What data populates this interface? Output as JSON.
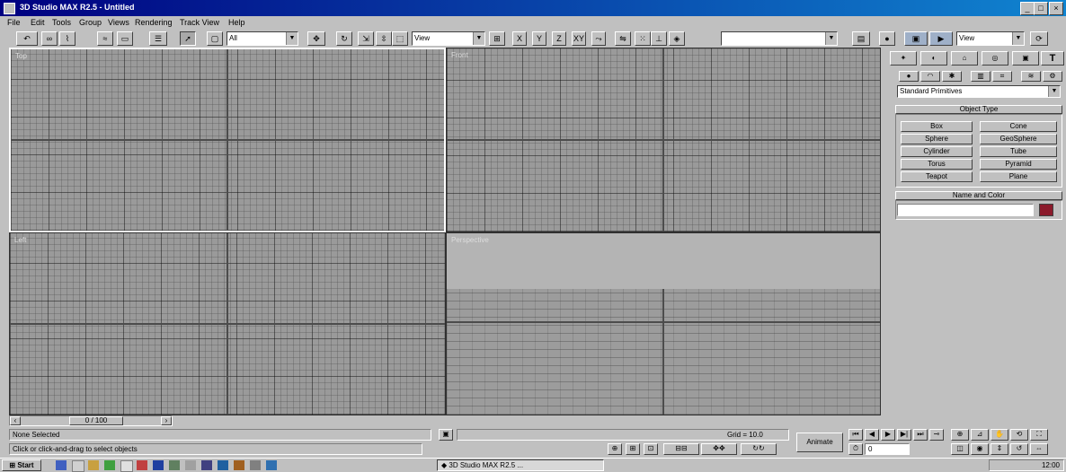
{
  "window": {
    "title": "3D Studio MAX R2.5 - Untitled",
    "minimize": "_",
    "maximize": "□",
    "close": "×"
  },
  "menu": [
    "File",
    "Edit",
    "Tools",
    "Group",
    "Views",
    "Rendering",
    "Track View",
    "Help"
  ],
  "toolbar": {
    "selection_filter": "All",
    "reference_coord": "View",
    "named_selection": "",
    "render_type": "View"
  },
  "viewports": {
    "top": "Top",
    "front": "Front",
    "left": "Left",
    "perspective": "Perspective"
  },
  "command_panel": {
    "category_dropdown": "Standard Primitives",
    "object_type_title": "Object Type",
    "object_buttons": [
      "Box",
      "Cone",
      "Sphere",
      "GeoSphere",
      "Cylinder",
      "Tube",
      "Torus",
      "Pyramid",
      "Teapot",
      "Plane"
    ],
    "name_color_title": "Name and Color",
    "name_value": "",
    "color": "#8b1a2b"
  },
  "timeline": {
    "frame_label": "0 / 100"
  },
  "status": {
    "selection": "None Selected",
    "prompt": "Click or click-and-drag to select objects",
    "grid": "Grid = 10.0",
    "animate": "Animate",
    "frame": "0"
  },
  "taskbar": {
    "start": "Start",
    "task": "3D Studio MAX R2.5 ...",
    "clock": "12:00"
  },
  "colors": {
    "titlebar": "#000080",
    "viewport_bg": "#9a9a9a",
    "face": "#c0c0c0"
  }
}
